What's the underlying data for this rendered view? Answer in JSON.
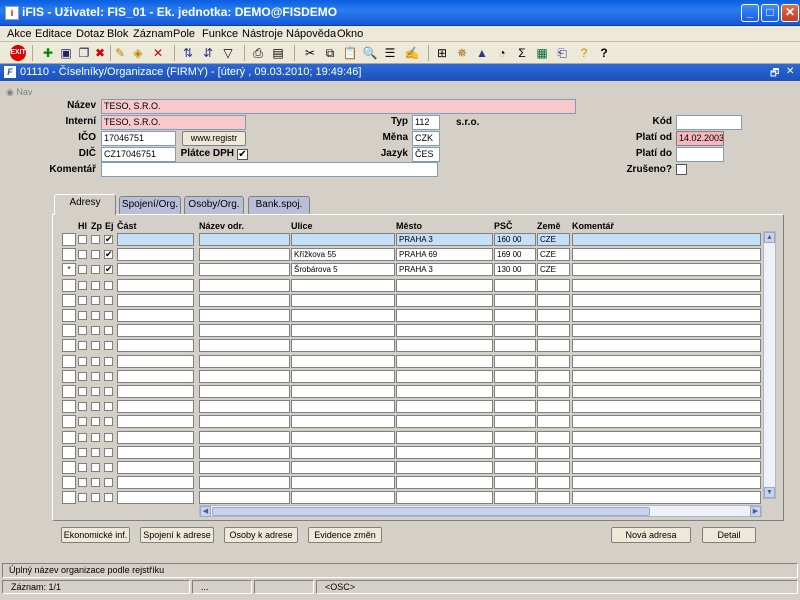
{
  "window": {
    "title": "iFIS - Uživatel: FIS_01 - Ek. jednotka: DEMO@FISDEMO",
    "minimize": "_",
    "maximize": "□",
    "close": "✕"
  },
  "menu": [
    "Akce",
    "Editace",
    "Dotaz",
    "Blok",
    "Záznam",
    "Pole",
    "Funkce",
    "Nástroje",
    "Nápověda",
    "Okno"
  ],
  "toolbar": {
    "exit": "EXIT",
    "icons": [
      "new-record-icon",
      "save-icon",
      "copy-icon",
      "delete-record-icon",
      "query-icon",
      "execute-query-icon",
      "print-icon",
      "cut-icon",
      "copy-text-icon",
      "paste-icon",
      "edit-icon",
      "list-icon",
      "attach-icon",
      "settings-icon",
      "chart-icon",
      "clock-icon",
      "sum-icon",
      "excel-icon",
      "export-icon",
      "help-icon",
      "question-icon"
    ]
  },
  "form_window": {
    "title": "01110 - Číselníky/Organizace (FIRMY) - [úterý , 09.03.2010; 19:49:46]",
    "restore": "🗗",
    "close": "✕"
  },
  "nav_label": "Nav",
  "form": {
    "nazev_label": "Název",
    "nazev_value": "TESO, S.R.O.",
    "interni_label": "Interní",
    "interni_value": "TESO, S.R.O.",
    "typ_label": "Typ",
    "typ_value": "112",
    "typ_desc": "s.r.o.",
    "kod_label": "Kód",
    "kod_value": "",
    "ico_label": "IČO",
    "ico_value": "17046751",
    "registr_button": "www.registr",
    "mena_label": "Měna",
    "mena_value": "CZK",
    "plati_od_label": "Platí od",
    "plati_od_value": "14.02.2003",
    "dic_label": "DIČ",
    "dic_value": "CZ17046751",
    "platce_dph_label": "Plátce DPH",
    "platce_dph_checked": true,
    "jazyk_label": "Jazyk",
    "jazyk_value": "ČES",
    "plati_do_label": "Platí do",
    "plati_do_value": "",
    "komentar_label": "Komentář",
    "komentar_value": "",
    "zruseno_label": "Zrušeno?"
  },
  "tabs": [
    "Adresy",
    "Spojení/Org.",
    "Osoby/Org.",
    "Bank.spoj."
  ],
  "grid": {
    "headers": {
      "hl": "Hl",
      "zp": "Zp",
      "ej": "Ej",
      "cast": "Část",
      "nazev_odr": "Název odr.",
      "ulice": "Ulice",
      "mesto": "Město",
      "psc": "PSČ",
      "zeme": "Země",
      "komentar": "Komentář"
    },
    "rows": [
      {
        "indicator": "",
        "ej": true,
        "cast": "",
        "nazev_odr": "",
        "ulice": "",
        "mesto": "PRAHA 3",
        "psc": "160 00",
        "zeme": "CZE",
        "komentar": ""
      },
      {
        "indicator": "",
        "ej": true,
        "cast": "",
        "nazev_odr": "",
        "ulice": "Křížkova 55",
        "mesto": "PRAHA 69",
        "psc": "169 00",
        "zeme": "CZE",
        "komentar": ""
      },
      {
        "indicator": "*",
        "ej": true,
        "cast": "",
        "nazev_odr": "",
        "ulice": "Šrobárova 5",
        "mesto": "PRAHA 3",
        "psc": "130 00",
        "zeme": "CZE",
        "komentar": ""
      }
    ],
    "empty_rows": 15
  },
  "buttons": {
    "ekonomicke": "Ekonomické inf.",
    "spojeni": "Spojení k adrese",
    "osoby": "Osoby k adrese",
    "evidence": "Evidence změn",
    "nova_adresa": "Nová adresa",
    "detail": "Detail"
  },
  "status": {
    "message": "Úplný název organizace podle rejstříku",
    "record": "Záznam: 1/1",
    "segment2": "...",
    "segment3": "",
    "osc": "<OSC>"
  }
}
